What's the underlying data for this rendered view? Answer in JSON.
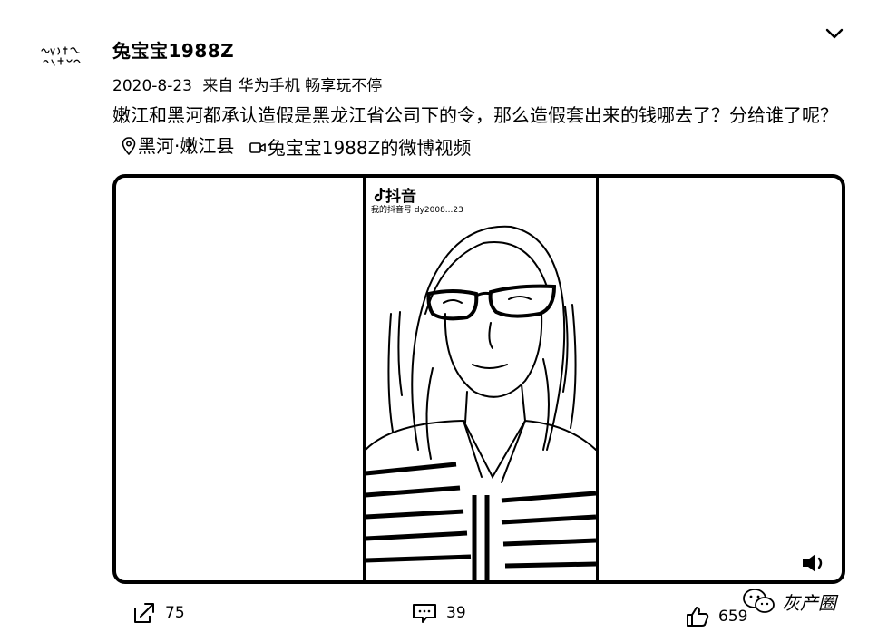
{
  "post": {
    "username": "兔宝宝1988Z",
    "date": "2020-8-23",
    "source": "来自 华为手机 畅享玩不停",
    "text": "嫩江和黑河都承认造假是黑龙江省公司下的令，那么造假套出来的钱哪去了？分给谁了呢？",
    "location_link": "黑河·嫩江县",
    "video_link": "兔宝宝1988Z的微博视频",
    "avatar_icon": "handwriting-avatar-icon"
  },
  "video": {
    "platform_label": "抖音",
    "uploader_id_text": "我的抖音号 dy2008...23",
    "mute_icon": "speaker-mute-icon"
  },
  "actions": {
    "share_count": "75",
    "comment_count": "39",
    "like_count": "659"
  },
  "watermark": {
    "text": "灰产圈",
    "icon": "wechat-icon"
  }
}
